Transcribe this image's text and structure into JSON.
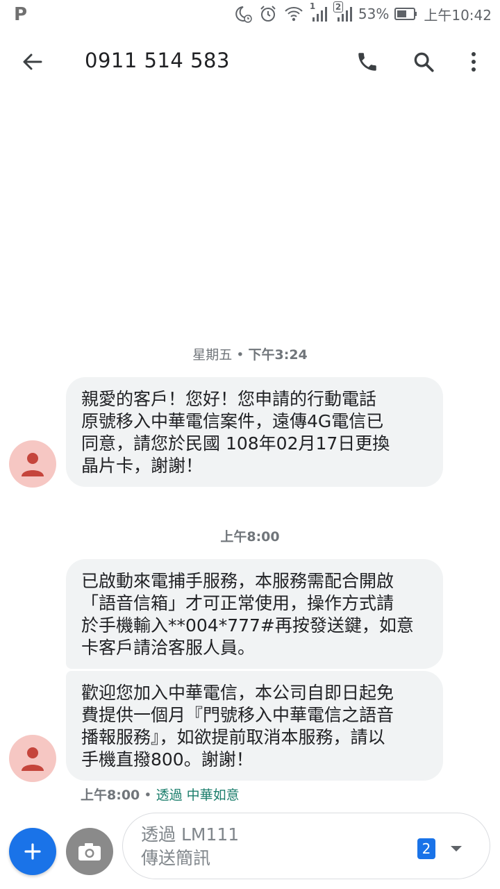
{
  "status_bar": {
    "left_glyph": "P",
    "sim1_label": "1",
    "sim2_label": "2",
    "battery_percent": "53%",
    "time": "上午10:42"
  },
  "app_bar": {
    "title": "0911 514 583",
    "icons": [
      "back-arrow-icon",
      "phone-icon",
      "search-icon",
      "more-vert-icon"
    ]
  },
  "conversation": {
    "timestamp_1_day": "星期五 • ",
    "timestamp_1_time": "下午3:24",
    "message_1": "親愛的客戶！您好！您申請的行動電話\n原號移入中華電信案件，遠傳4G電信已\n同意，請您於民國 108年02月17日更換\n晶片卡，謝謝！",
    "timestamp_2": "上午8:00",
    "message_2": "已啟動來電捕手服務，本服務需配合開啟\n「語音信箱」才可正常使用，操作方式請\n於手機輸入**004*777#再按發送鍵，如意\n卡客戶請洽客服人員。",
    "message_3": "歡迎您加入中華電信，本公司自即日起免\n費提供一個月『門號移入中華電信之語音\n播報服務』，如欲提前取消本服務，請以\n手機直撥800。謝謝！",
    "via_time": "上午8:00",
    "via_sep": " • ",
    "via_carrier": "透過 中華如意"
  },
  "compose": {
    "placeholder": "透過 LM111\n傳送簡訊",
    "sim_badge": "2"
  },
  "colors": {
    "accent": "#1a73e8",
    "bubble": "#f1f3f4",
    "avatar_bg": "#f6c7c3",
    "avatar_fg": "#c5453c",
    "carrier_text": "#1a7d6b"
  }
}
